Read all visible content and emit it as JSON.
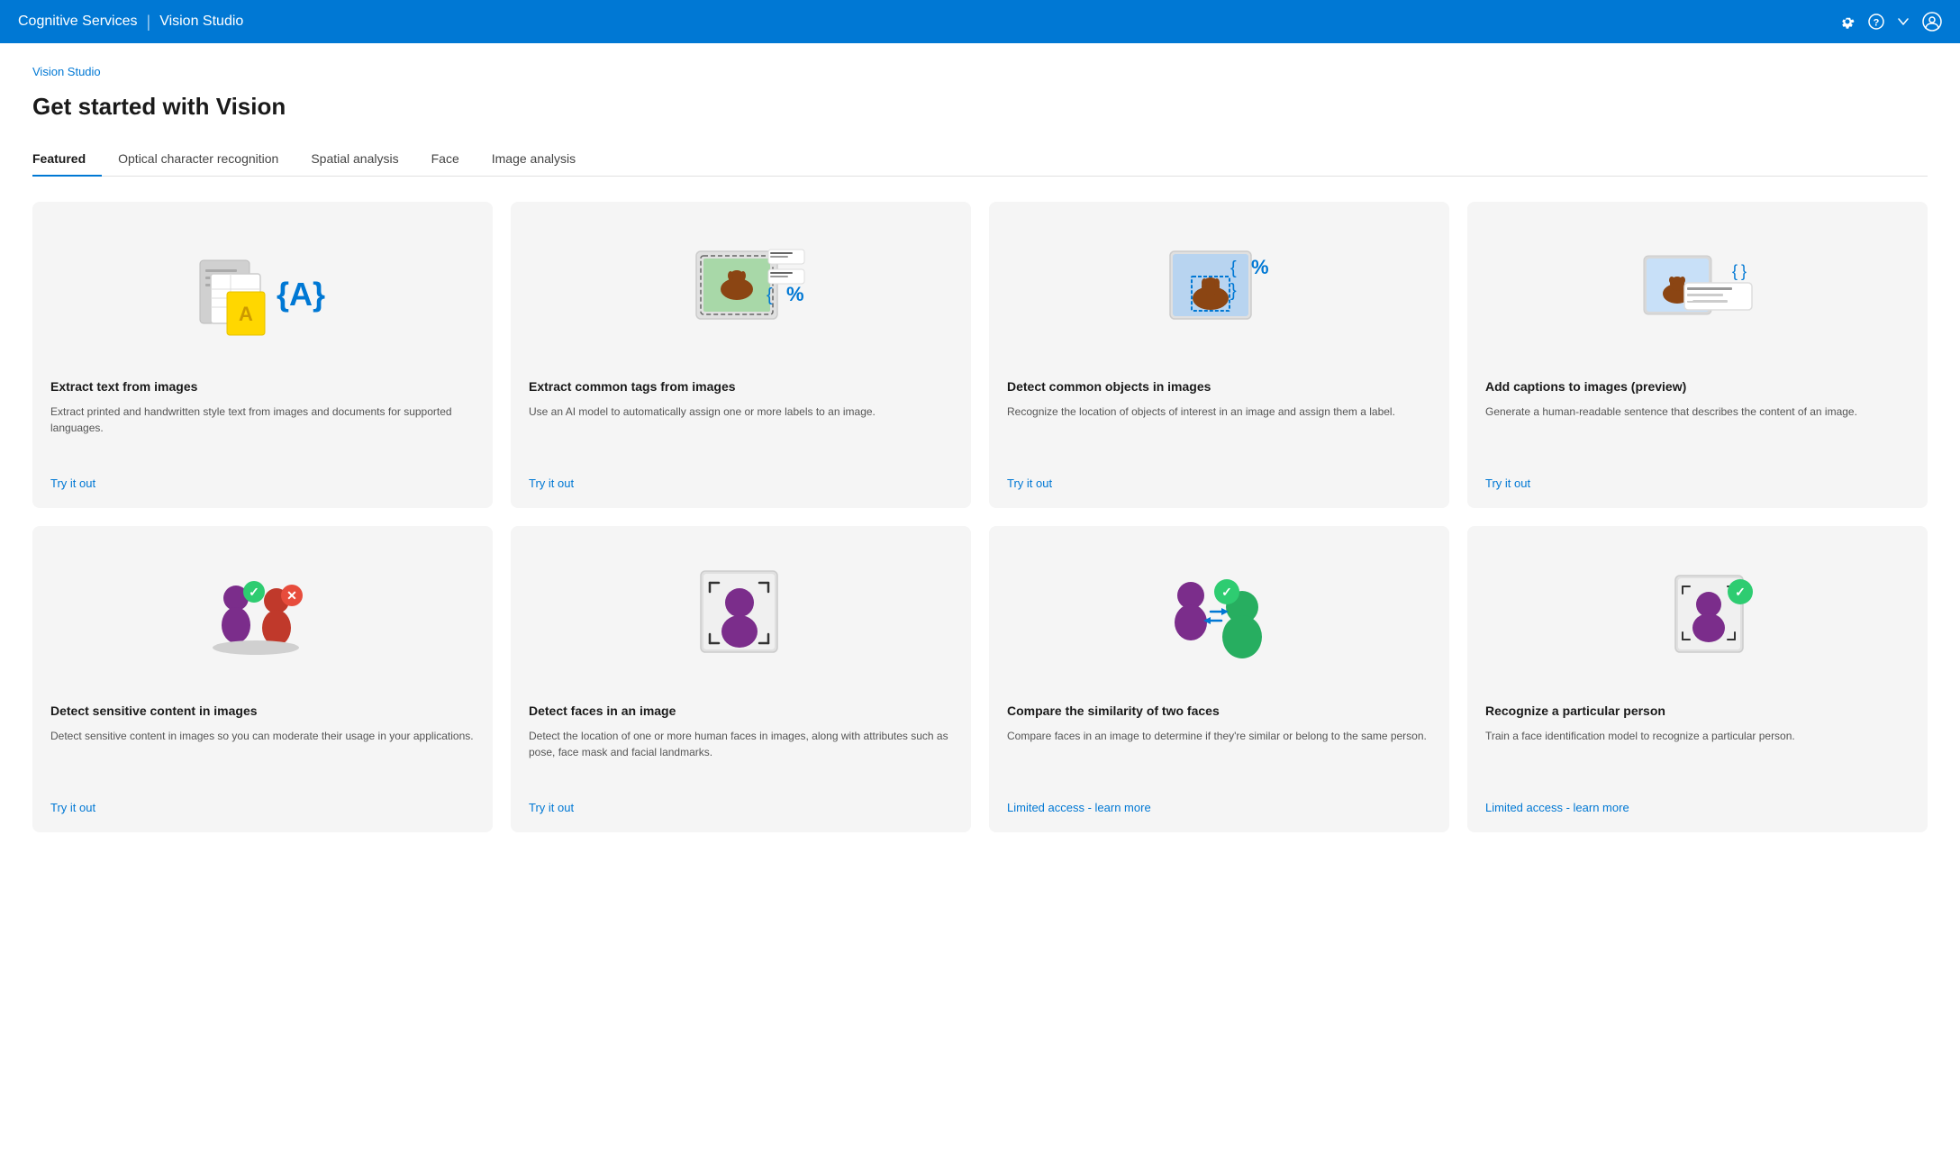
{
  "header": {
    "app_name": "Cognitive Services",
    "divider": "|",
    "studio_name": "Vision Studio",
    "icons": [
      "settings",
      "help",
      "chevron-down",
      "profile"
    ]
  },
  "breadcrumb": "Vision Studio",
  "page_title": "Get started with Vision",
  "tabs": [
    {
      "label": "Featured",
      "active": true
    },
    {
      "label": "Optical character recognition",
      "active": false
    },
    {
      "label": "Spatial analysis",
      "active": false
    },
    {
      "label": "Face",
      "active": false
    },
    {
      "label": "Image analysis",
      "active": false
    }
  ],
  "cards_row1": [
    {
      "id": "extract-text",
      "title": "Extract text from images",
      "description": "Extract printed and handwritten style text from images and documents for supported languages.",
      "action": "Try it out",
      "action_type": "link"
    },
    {
      "id": "extract-tags",
      "title": "Extract common tags from images",
      "description": "Use an AI model to automatically assign one or more labels to an image.",
      "action": "Try it out",
      "action_type": "link"
    },
    {
      "id": "detect-objects",
      "title": "Detect common objects in images",
      "description": "Recognize the location of objects of interest in an image and assign them a label.",
      "action": "Try it out",
      "action_type": "link"
    },
    {
      "id": "add-captions",
      "title": "Add captions to images (preview)",
      "description": "Generate a human-readable sentence that describes the content of an image.",
      "action": "Try it out",
      "action_type": "link"
    }
  ],
  "cards_row2": [
    {
      "id": "detect-sensitive",
      "title": "Detect sensitive content in images",
      "description": "Detect sensitive content in images so you can moderate their usage in your applications.",
      "action": "Try it out",
      "action_type": "link"
    },
    {
      "id": "detect-faces",
      "title": "Detect faces in an image",
      "description": "Detect the location of one or more human faces in images, along with attributes such as pose, face mask and facial landmarks.",
      "action": "Try it out",
      "action_type": "link"
    },
    {
      "id": "compare-faces",
      "title": "Compare the similarity of two faces",
      "description": "Compare faces in an image to determine if they're similar or belong to the same person.",
      "action": "Limited access - learn more",
      "action_type": "link"
    },
    {
      "id": "recognize-person",
      "title": "Recognize a particular person",
      "description": "Train a face identification model to recognize a particular person.",
      "action": "Limited access - learn more",
      "action_type": "link"
    }
  ],
  "colors": {
    "primary": "#0078d4",
    "header_bg": "#0078d4",
    "card_bg": "#f5f5f5",
    "title_color": "#1a1a1a",
    "desc_color": "#555555",
    "action_color": "#0078d4"
  }
}
